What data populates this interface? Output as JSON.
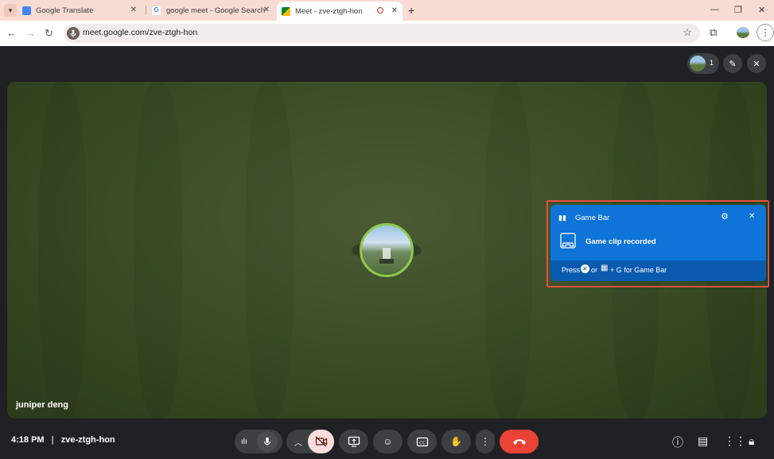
{
  "browser": {
    "tabs": [
      {
        "title": "Google Translate",
        "favicon": "translate-icon"
      },
      {
        "title": "google meet - Google Search",
        "favicon": "google-icon"
      },
      {
        "title": "Meet - zve-ztgh-hon",
        "favicon": "meet-icon",
        "active": true
      }
    ],
    "new_tab": "+",
    "url": "meet.google.com/zve-ztgh-hon"
  },
  "meet": {
    "participant_count": "1",
    "participant_name": "juniper deng",
    "time": "4:18 PM",
    "meeting_code": "zve-ztgh-hon"
  },
  "gamebar": {
    "app_name": "Game Bar",
    "message": "Game clip recorded",
    "footer_press": "Press",
    "footer_or": "or",
    "footer_rest": "+ G for Game Bar"
  },
  "colors": {
    "tabstrip": "#f8dcd3",
    "gamebar_blue": "#0f74d8",
    "leave_red": "#ea4335",
    "cam_off_bg": "#f9dedc",
    "highlight": "#e0523e"
  }
}
